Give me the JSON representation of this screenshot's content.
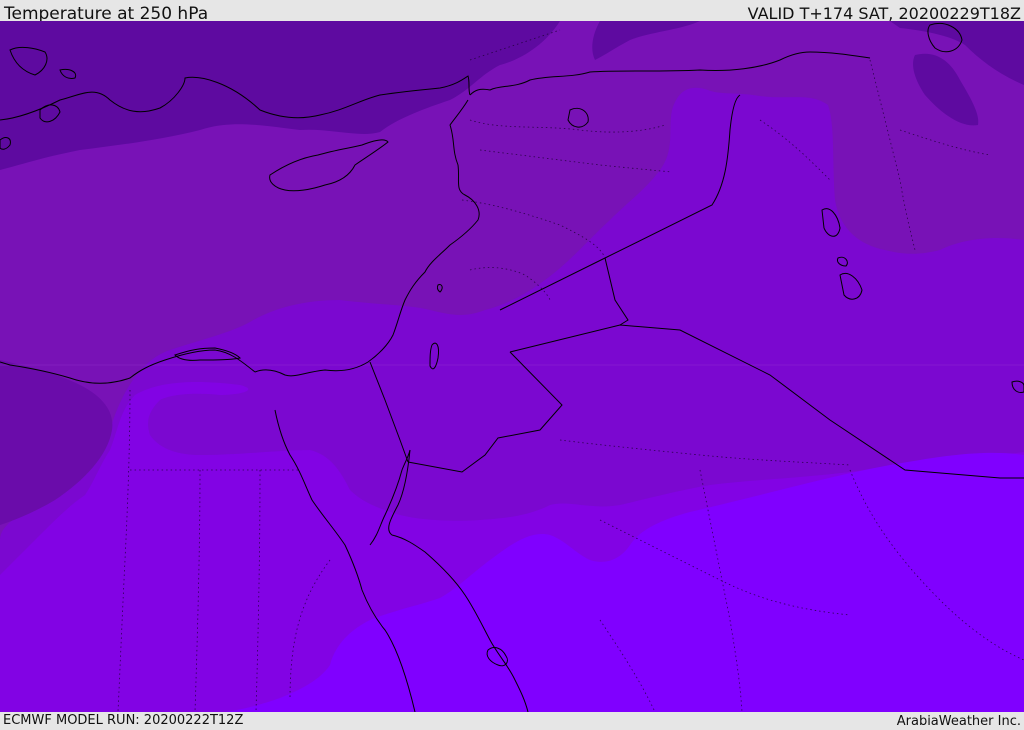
{
  "header": {
    "title": "Temperature at 250 hPa",
    "valid": "VALID T+174 SAT, 20200229T18Z"
  },
  "footer": {
    "model_run": "ECMWF MODEL RUN: 20200222T12Z",
    "credit": "ArabiaWeather Inc."
  },
  "map": {
    "field": "Temperature",
    "level": "250 hPa",
    "shading_colors": [
      "#5e0aa0",
      "#6a0caa",
      "#7812b6",
      "#7b08d0",
      "#8203e4",
      "#8000ff"
    ],
    "coastline_color": "#000000",
    "border_style": "solid",
    "subdivision_style": "dotted"
  }
}
